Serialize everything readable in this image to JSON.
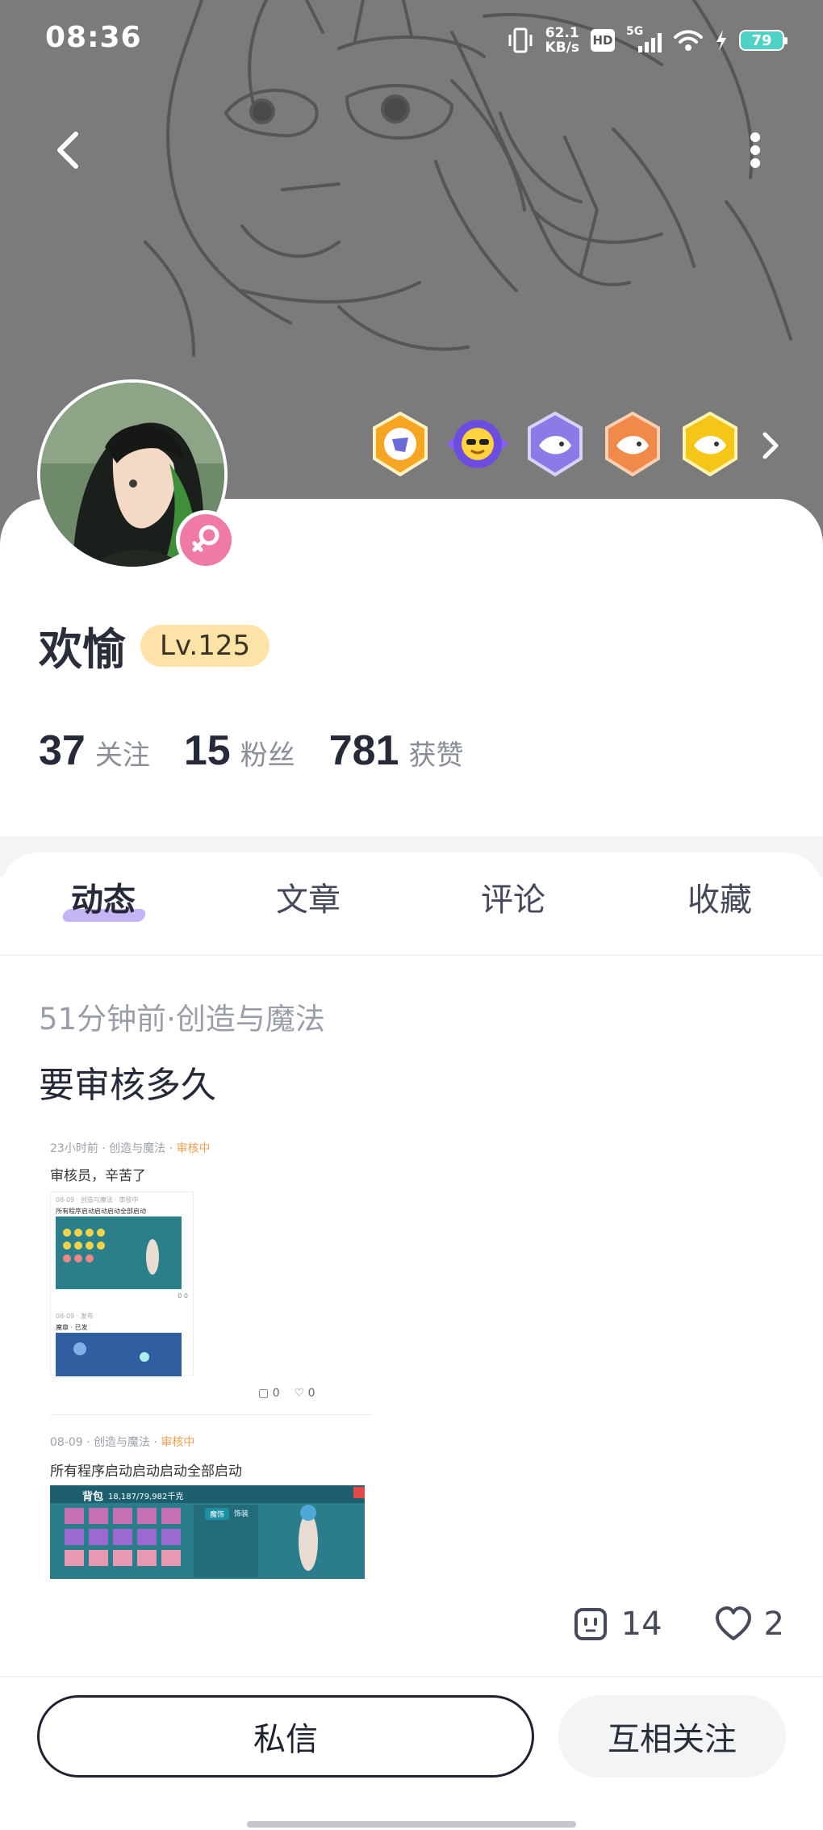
{
  "status_bar": {
    "time": "08:36",
    "net_speed_value": "62.1",
    "net_speed_unit": "KB/s",
    "hd_label": "HD",
    "network_label": "5G",
    "battery_level": "79"
  },
  "icons": {
    "back": "chevron-left-icon",
    "more": "vertical-dots-icon",
    "medal_arrow": "chevron-right-icon",
    "gender": "female-icon",
    "comment": "comment-icon",
    "like": "heart-icon"
  },
  "medals": [
    "shield-badge",
    "sunglasses-sun-badge",
    "fish-shield-badge",
    "orange-fish-badge",
    "gold-fish-badge"
  ],
  "profile": {
    "name": "欢愉",
    "level": "Lv.125",
    "following_count": "37",
    "following_label": "关注",
    "followers_count": "15",
    "followers_label": "粉丝",
    "likes_count": "781",
    "likes_label": "获赞"
  },
  "tabs": [
    {
      "label": "动态",
      "active": true
    },
    {
      "label": "文章",
      "active": false
    },
    {
      "label": "评论",
      "active": false
    },
    {
      "label": "收藏",
      "active": false
    }
  ],
  "post": {
    "meta": "51分钟前·创造与魔法",
    "title": "要审核多久",
    "comment_count": "14",
    "like_count": "2",
    "image": {
      "meta1_prefix": "23小时前 · 创造与魔法 · ",
      "meta1_status": "审核中",
      "title1": "审核员，辛苦了",
      "inner_meta1": "08-09 · 创造与魔法 · 审核中",
      "inner_title1": "所有程序启动启动启动全部启动",
      "inner_counts": "0   0",
      "inner_meta2": "08-09 · 发布",
      "inner_title2": "魔章 · 已发",
      "footer_comments": "0",
      "footer_likes": "0",
      "meta2_prefix": "08-09 · 创造与魔法 · ",
      "meta2_status": "审核中",
      "title2": "所有程序启动启动启动全部启动",
      "game_title": "背包",
      "game_money": "18,187/79,982千克",
      "game_tab1": "魔饰",
      "game_tab2": "饰装"
    }
  },
  "actions": {
    "message_button": "私信",
    "follow_button": "互相关注"
  },
  "colors": {
    "accent_purple": "#c6b5f5",
    "level_badge": "#fde3a7",
    "gender_pink": "#f07aa6",
    "review_orange": "#f0a050"
  }
}
